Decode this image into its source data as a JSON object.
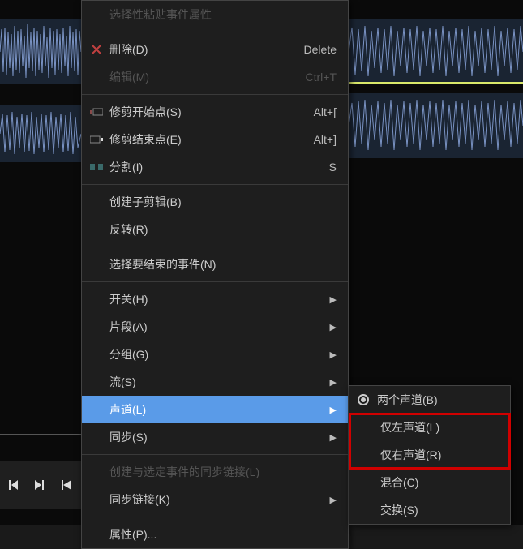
{
  "menu_top_disabled": {
    "label": "选择性粘贴事件属性"
  },
  "menu": {
    "delete": {
      "label": "删除(D)",
      "shortcut": "Delete"
    },
    "edit_m": {
      "label": "编辑(M)",
      "shortcut": "Ctrl+T"
    },
    "trim_start": {
      "label": "修剪开始点(S)",
      "shortcut": "Alt+["
    },
    "trim_end": {
      "label": "修剪结束点(E)",
      "shortcut": "Alt+]"
    },
    "split": {
      "label": "分割(I)",
      "shortcut": "S"
    },
    "subclip": {
      "label": "创建子剪辑(B)"
    },
    "reverse": {
      "label": "反转(R)"
    },
    "select_end": {
      "label": "选择要结束的事件(N)"
    },
    "switch": {
      "label": "开关(H)"
    },
    "take": {
      "label": "片段(A)"
    },
    "group": {
      "label": "分组(G)"
    },
    "stream": {
      "label": "流(S)"
    },
    "channel": {
      "label": "声道(L)"
    },
    "sync": {
      "label": "同步(S)"
    },
    "sync_link_create": {
      "label": "创建与选定事件的同步链接(L)"
    },
    "sync_link": {
      "label": "同步链接(K)"
    },
    "props": {
      "label": "属性(P)..."
    }
  },
  "channel_submenu": {
    "both": {
      "label": "两个声道(B)"
    },
    "left": {
      "label": "仅左声道(L)"
    },
    "right": {
      "label": "仅右声道(R)"
    },
    "mix": {
      "label": "混合(C)"
    },
    "swap": {
      "label": "交换(S)"
    }
  }
}
